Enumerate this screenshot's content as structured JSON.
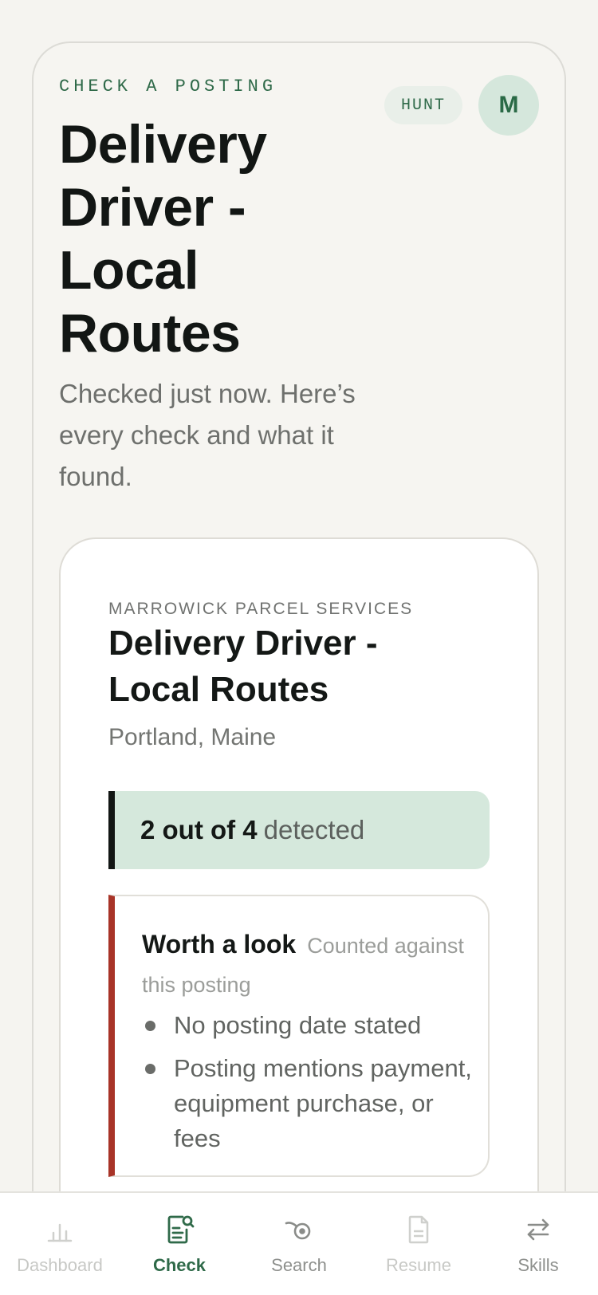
{
  "header": {
    "eyebrow": "CHECK A POSTING",
    "hunt_badge": "HUNT",
    "avatar_initial": "M",
    "title": "Delivery Driver - Local Routes",
    "subtitle": "Checked just now. Here’s every check and what it found."
  },
  "posting": {
    "company": "MARROWICK PARCEL SERVICES",
    "title": "Delivery Driver - Local Routes",
    "location": "Portland, Maine",
    "summary_count": "2 out of 4",
    "summary_word": "detected"
  },
  "flags": {
    "title": "Worth a look",
    "note": "Counted against this posting",
    "items": [
      "No posting date stated",
      "Posting mentions payment, equipment purchase, or fees"
    ]
  },
  "tabs": [
    {
      "label": "Dashboard",
      "icon": "bar-chart-icon",
      "state": "disabled"
    },
    {
      "label": "Check",
      "icon": "document-search-icon",
      "state": "active"
    },
    {
      "label": "Search",
      "icon": "radar-icon",
      "state": "normal"
    },
    {
      "label": "Resume",
      "icon": "document-icon",
      "state": "disabled"
    },
    {
      "label": "Skills",
      "icon": "swap-arrows-icon",
      "state": "normal"
    }
  ],
  "colors": {
    "accent": "#2f6a49",
    "summary_bg": "#d5e8dc",
    "warning_bar": "#a83428",
    "background": "#f5f4f0"
  }
}
